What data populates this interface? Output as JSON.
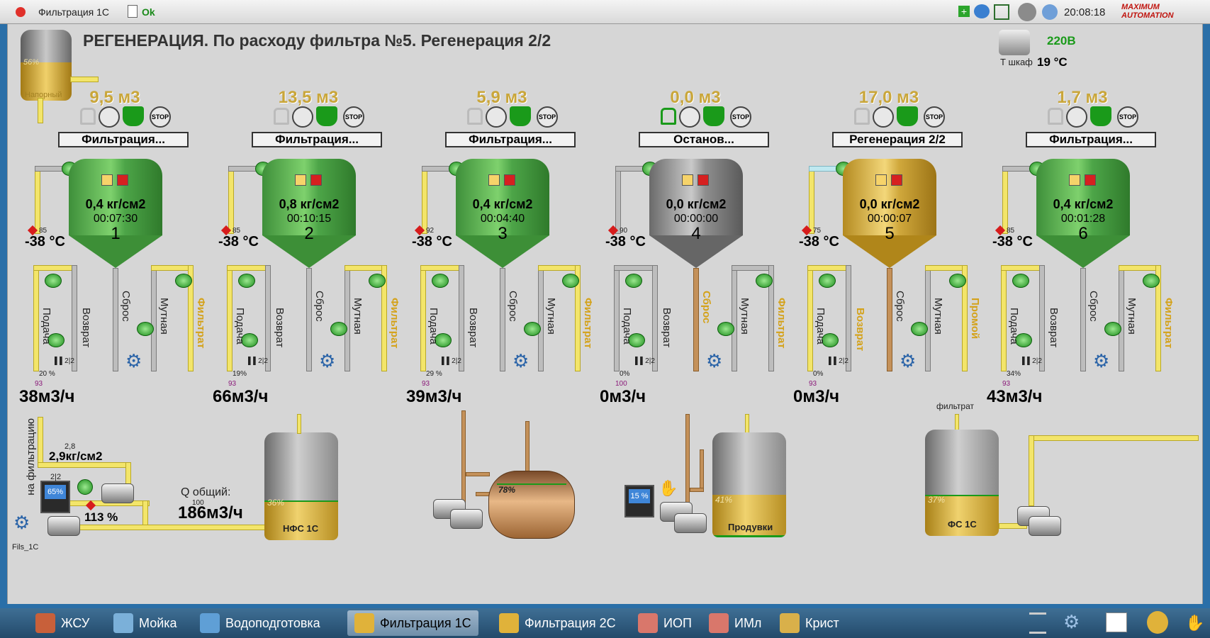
{
  "topbar": {
    "window_title": "Фильтрация 1С",
    "status": "Ok",
    "time": "20:08:18",
    "brand": "MAXIMUM AUTOMATION"
  },
  "header": {
    "title": "РЕГЕНЕРАЦИЯ. По расходу фильтра №5. Регенерация 2/2",
    "voltage": "220В",
    "cabinet_label": "Т шкаф",
    "cabinet_temp": "19 °C",
    "aux_tank_percent": "56%",
    "aux_tank_label": "Напорный"
  },
  "filters": [
    {
      "volume": "9,5 м3",
      "status": "Фильтрация...",
      "pressure": "0,4 кг/см2",
      "time": "00:07:30",
      "num": "1",
      "temp": "-38 °C",
      "temp_set": "85",
      "pct": "20 %",
      "flow": "38м3/ч",
      "flow_set": "93",
      "color": "green"
    },
    {
      "volume": "13,5 м3",
      "status": "Фильтрация...",
      "pressure": "0,8 кг/см2",
      "time": "00:10:15",
      "num": "2",
      "temp": "-38 °C",
      "temp_set": "85",
      "pct": "19%",
      "flow": "66м3/ч",
      "flow_set": "93",
      "color": "green"
    },
    {
      "volume": "5,9 м3",
      "status": "Фильтрация...",
      "pressure": "0,4 кг/см2",
      "time": "00:04:40",
      "num": "3",
      "temp": "-38 °C",
      "temp_set": "92",
      "pct": "29 %",
      "flow": "39м3/ч",
      "flow_set": "93",
      "color": "green"
    },
    {
      "volume": "0,0 м3",
      "status": "Останов...",
      "pressure": "0,0 кг/см2",
      "time": "00:00:00",
      "num": "4",
      "temp": "-38 °C",
      "temp_set": "90",
      "pct": "0%",
      "flow": "0м3/ч",
      "flow_set": "100",
      "color": "gray"
    },
    {
      "volume": "17,0 м3",
      "status": "Регенерация 2/2",
      "pressure": "0,0 кг/см2",
      "time": "00:00:07",
      "num": "5",
      "temp": "-38 °C",
      "temp_set": "75",
      "pct": "0%",
      "flow": "0м3/ч",
      "flow_set": "93",
      "color": "gold"
    },
    {
      "volume": "1,7 м3",
      "status": "Фильтрация...",
      "pressure": "0,4 кг/см2",
      "time": "00:01:28",
      "num": "6",
      "temp": "-38 °C",
      "temp_set": "85",
      "pct": "34%",
      "flow": "43м3/ч",
      "flow_set": "93",
      "color": "green"
    }
  ],
  "pipe_labels": {
    "supply": "Подача",
    "return": "Возврат",
    "drain": "Сброс",
    "muddy": "Мутная",
    "filtrate": "Фильтрат",
    "rinse": "Промой"
  },
  "bottom": {
    "to_filtration": "на фильтрацию",
    "pressure_set": "2,8",
    "pressure": "2,9кг/см2",
    "pump_mode": "2|2",
    "pump_pct": "65%",
    "pump_load": "113 %",
    "q_label": "Q общий:",
    "q_set": "100",
    "q_total": "186м3/ч",
    "nfs_label": "НФС 1С",
    "nfs_pct": "36%",
    "drum_pct": "78%",
    "purge_pct": "15 %",
    "purge_tank_pct": "41%",
    "purge_tank_label": "Продувки",
    "fs_top_label": "фильтрат",
    "fs_label": "ФС 1С",
    "fs_pct": "37%",
    "footer_id": "Fils_1C"
  },
  "taskbar": [
    {
      "label": "ЖСУ",
      "color": "#c8603a"
    },
    {
      "label": "Мойка",
      "color": "#7bb0d9"
    },
    {
      "label": "Водоподготовка",
      "color": "#5f9fd6"
    },
    {
      "label": "Фильтрация 1С",
      "color": "#e0b23a",
      "active": true
    },
    {
      "label": "Фильтрация 2С",
      "color": "#e0b23a"
    },
    {
      "label": "ИОП",
      "color": "#d9776b"
    },
    {
      "label": "ИМл",
      "color": "#d9776b"
    },
    {
      "label": "Крист",
      "color": "#d9b04a"
    }
  ]
}
